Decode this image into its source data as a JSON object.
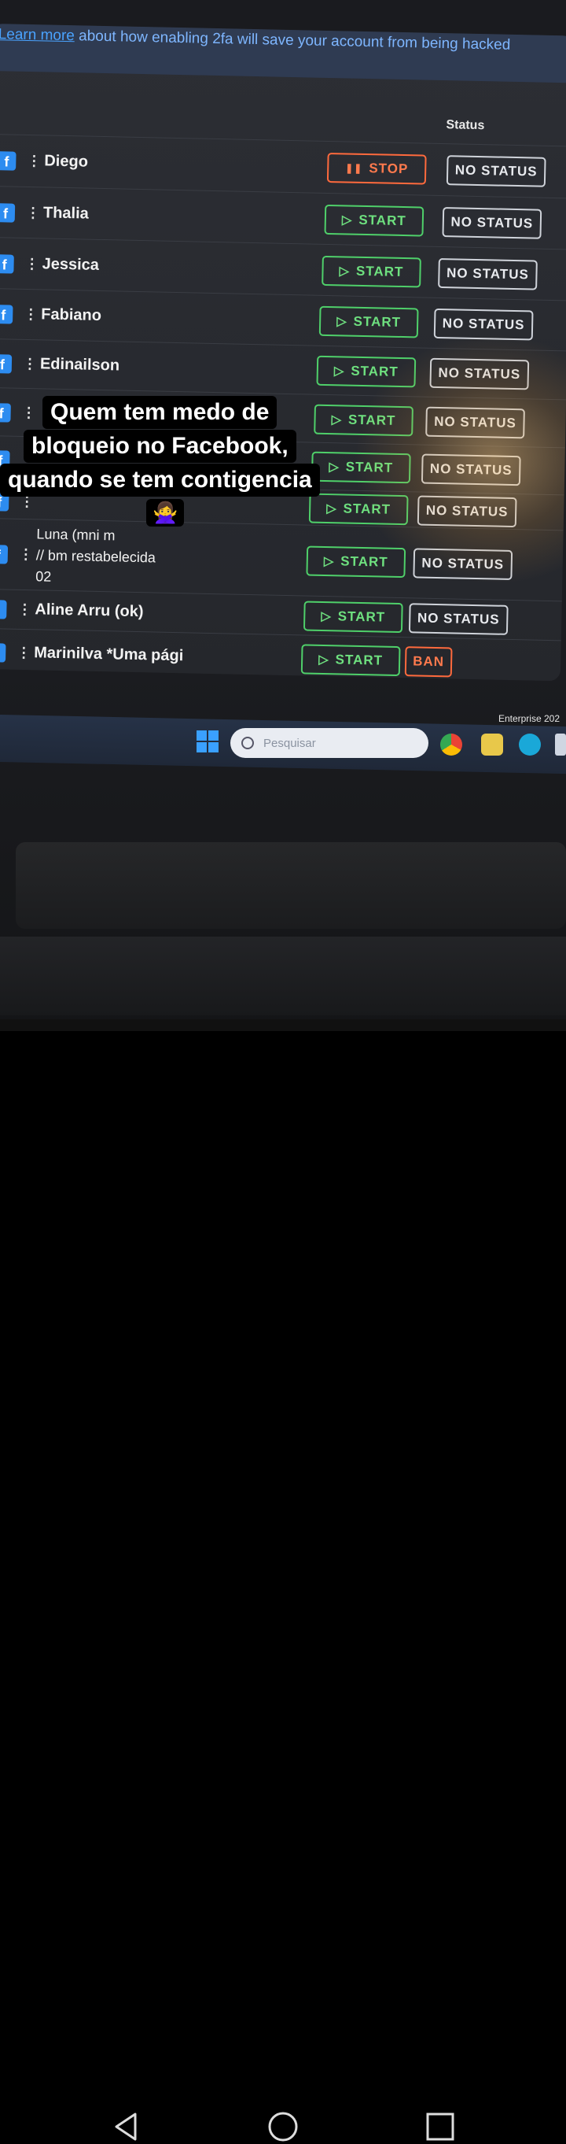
{
  "banner": {
    "link_text": "Learn more",
    "text": " about how enabling 2fa will save your account from being hacked"
  },
  "table": {
    "status_header": "Status",
    "rows": [
      {
        "name": "Diego",
        "action": "STOP",
        "status": "NO STATUS"
      },
      {
        "name": "Thalia",
        "action": "START",
        "status": "NO STATUS"
      },
      {
        "name": "Jessica",
        "action": "START",
        "status": "NO STATUS"
      },
      {
        "name": "Fabiano",
        "action": "START",
        "status": "NO STATUS"
      },
      {
        "name": "Edinailson",
        "action": "START",
        "status": "NO STATUS"
      },
      {
        "name": "",
        "action": "START",
        "status": "NO STATUS"
      },
      {
        "name": "",
        "action": "START",
        "status": "NO STATUS"
      },
      {
        "name": "",
        "action": "START",
        "status": "NO STATUS"
      },
      {
        "name": "Luna (mni m",
        "name2": "// bm restabelecida",
        "name3": "02",
        "action": "START",
        "status": "NO STATUS"
      },
      {
        "name": "Aline Arru (ok)",
        "action": "START",
        "status": "NO STATUS"
      },
      {
        "name": "Marinilva *Uma pági",
        "action": "START",
        "status": "BAN"
      }
    ]
  },
  "taskbar": {
    "search_placeholder": "Pesquisar",
    "edition": "Enterprise 202"
  },
  "caption": {
    "line1": "Quem tem medo de",
    "line2": "bloqueio no Facebook,",
    "line3": "quando se tem contigencia",
    "emoji": "🙅‍♀️"
  },
  "colors": {
    "start": "#4fd06a",
    "stop": "#ff6a3d",
    "status": "#cfd3da",
    "facebook": "#2d8cf0"
  }
}
